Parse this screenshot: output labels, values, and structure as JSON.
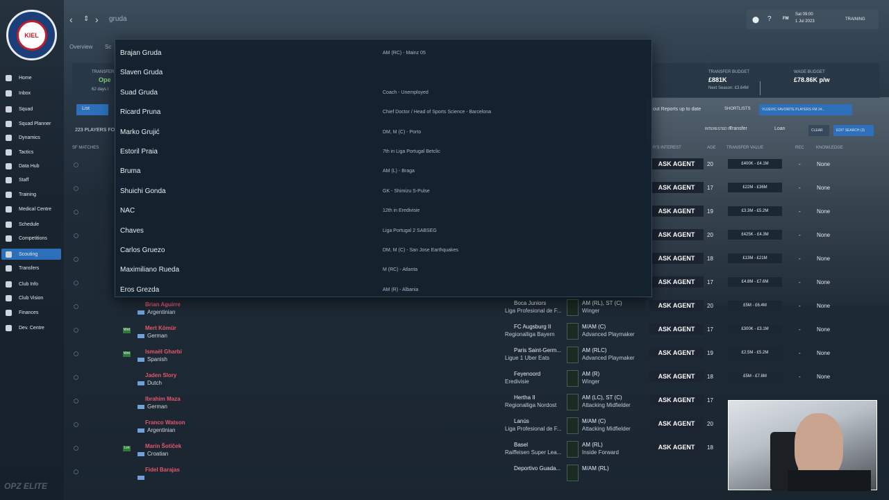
{
  "topbar": {
    "search_text": "gruda",
    "date_line1": "Sat 09:00",
    "date_line2": "1 Jul 2023",
    "fm_label": "FM",
    "training_label": "TRAINING"
  },
  "sidebar": {
    "crest_text": "KIEL",
    "items": [
      {
        "label": "Home"
      },
      {
        "label": "Inbox"
      },
      {
        "label": "Squad"
      },
      {
        "label": "Squad Planner"
      },
      {
        "label": "Dynamics"
      },
      {
        "label": "Tactics"
      },
      {
        "label": "Data Hub"
      },
      {
        "label": "Staff"
      },
      {
        "label": "Training"
      },
      {
        "label": "Medical Centre"
      },
      {
        "label": "Schedule"
      },
      {
        "label": "Competitions"
      },
      {
        "label": "Scouting"
      },
      {
        "label": "Transfers"
      },
      {
        "label": "Club Info"
      },
      {
        "label": "Club Vision"
      },
      {
        "label": "Finances"
      },
      {
        "label": "Dev. Centre"
      }
    ]
  },
  "subtabs": {
    "overview": "Overview",
    "other": "Sc"
  },
  "panel": {
    "transfer_label": "TRANSFER",
    "transfer_status": "Ope",
    "transfer_days": "62 days l",
    "budget_label": "TRANSFER BUDGET",
    "budget_value": "£881K",
    "budget_next": "Next Season: £3.64M",
    "wage_label": "WAGE BUDGET",
    "wage_value": "£78.86K p/w"
  },
  "toolbar": {
    "list_label": "List",
    "players_count": "223 PLAYERS FO",
    "reports_text": "out Reports up to date",
    "shortlists": "SHORTLISTS",
    "favorite": "VUJEVIC FAVORITE PLAYERS FM 24...",
    "interested_in": "INTERESTED IN",
    "transfer": "Transfer",
    "loan": "Loan",
    "clear": "CLEAR",
    "edit_search": "EDIT SEARCH (3)"
  },
  "columns": {
    "sf_matches": "SF MATCHES",
    "interest": "R'S INTEREST",
    "age": "AGE",
    "value": "TRANSFER VALUE",
    "rec": "REC",
    "knowledge": "KNOWLEDGE"
  },
  "dropdown": [
    {
      "name": "Brajan Gruda",
      "desc": "AM (RC) - Mainz 05"
    },
    {
      "name": "Slaven Gruda",
      "desc": ""
    },
    {
      "name": "Suad Gruda",
      "desc": "Coach - Unemployed"
    },
    {
      "name": "Ricard Pruna",
      "desc": "Chief Doctor / Head of Sports Science - Barcelona"
    },
    {
      "name": "Marko Grujić",
      "desc": "DM, M (C) - Porto"
    },
    {
      "name": "Estoril Praia",
      "desc": "7th in Liga Portugal Betclic"
    },
    {
      "name": "Bruma",
      "desc": "AM (L) - Braga"
    },
    {
      "name": "Shuichi Gonda",
      "desc": "GK - Shimizu S-Pulse"
    },
    {
      "name": "NAC",
      "desc": "12th in Eredivisie"
    },
    {
      "name": "Chaves",
      "desc": "Liga Portugal 2 SABSEG"
    },
    {
      "name": "Carlos Gruezo",
      "desc": "DM, M (C) - San Jose Earthquakes"
    },
    {
      "name": "Maximiliano Rueda",
      "desc": "M (RC) - Atlanta"
    },
    {
      "name": "Eros Grezda",
      "desc": "AM (R) - Albania"
    }
  ],
  "rows": [
    {
      "name": "",
      "nation": "",
      "club": "",
      "league": "",
      "pos": "",
      "role": "",
      "ask": "ASK AGENT",
      "age": "20",
      "value": "£400K - £4.1M",
      "rec": "-",
      "knowledge": "None",
      "badge": ""
    },
    {
      "name": "",
      "nation": "",
      "club": "",
      "league": "",
      "pos": "",
      "role": "",
      "ask": "ASK AGENT",
      "age": "17",
      "value": "£22M - £36M",
      "rec": "-",
      "knowledge": "None",
      "badge": ""
    },
    {
      "name": "",
      "nation": "",
      "club": "",
      "league": "",
      "pos": "",
      "role": "",
      "ask": "ASK AGENT",
      "age": "19",
      "value": "£3.3M - £5.2M",
      "rec": "-",
      "knowledge": "None",
      "badge": ""
    },
    {
      "name": "",
      "nation": "",
      "club": "",
      "league": "",
      "pos": "",
      "role": "",
      "ask": "ASK AGENT",
      "age": "20",
      "value": "£425K - £4.3M",
      "rec": "-",
      "knowledge": "None",
      "badge": ""
    },
    {
      "name": "",
      "nation": "",
      "club": "",
      "league": "",
      "pos": "",
      "role": "",
      "ask": "ASK AGENT",
      "age": "18",
      "value": "£13M - £21M",
      "rec": "-",
      "knowledge": "None",
      "badge": ""
    },
    {
      "name": "",
      "nation": "",
      "club": "",
      "league": "",
      "pos": "",
      "role": "",
      "ask": "ASK AGENT",
      "age": "17",
      "value": "£4.8M - £7.6M",
      "rec": "-",
      "knowledge": "None",
      "badge": ""
    },
    {
      "name": "Brian Aguirre",
      "nation": "Argentinian",
      "club": "Boca Juniors",
      "league": "Liga Profesional de F...",
      "pos": "AM (RL), ST (C)",
      "role": "Winger",
      "ask": "ASK AGENT",
      "age": "20",
      "value": "£5M - £6.4M",
      "rec": "-",
      "knowledge": "None",
      "badge": ""
    },
    {
      "name": "Mert Kömür",
      "nation": "German",
      "club": "FC Augsburg II",
      "league": "Regionalliga Bayern",
      "pos": "M/AM (C)",
      "role": "Advanced Playmaker",
      "ask": "ASK AGENT",
      "age": "17",
      "value": "£300K - £3.1M",
      "rec": "-",
      "knowledge": "None",
      "badge": "Wnt"
    },
    {
      "name": "Ismaël Gharbi",
      "nation": "Spanish",
      "club": "Paris Saint-Germ...",
      "league": "Ligue 1 Uber Eats",
      "pos": "AM (RLC)",
      "role": "Advanced Playmaker",
      "ask": "ASK AGENT",
      "age": "19",
      "value": "£2.5M - £5.2M",
      "rec": "-",
      "knowledge": "None",
      "badge": "Wnt"
    },
    {
      "name": "Jaden Slory",
      "nation": "Dutch",
      "club": "Feyenoord",
      "league": "Eredivisie",
      "pos": "AM (R)",
      "role": "Winger",
      "ask": "ASK AGENT",
      "age": "18",
      "value": "£5M - £7.8M",
      "rec": "-",
      "knowledge": "None",
      "badge": ""
    },
    {
      "name": "Ibrahim Maza",
      "nation": "German",
      "club": "Hertha II",
      "league": "Regionalliga Nordost",
      "pos": "AM (LC), ST (C)",
      "role": "Attacking Midfielder",
      "ask": "ASK AGENT",
      "age": "17",
      "value": "",
      "rec": "",
      "knowledge": "",
      "badge": ""
    },
    {
      "name": "Franco Watson",
      "nation": "Argentinian",
      "club": "Lanús",
      "league": "Liga Profesional de F...",
      "pos": "M/AM (C)",
      "role": "Attacking Midfielder",
      "ask": "ASK AGENT",
      "age": "20",
      "value": "",
      "rec": "",
      "knowledge": "",
      "badge": ""
    },
    {
      "name": "Marin Šotiček",
      "nation": "Croatian",
      "club": "Basel",
      "league": "Raiffeisen Super Lea...",
      "pos": "AM (RL)",
      "role": "Inside Forward",
      "ask": "ASK AGENT",
      "age": "18",
      "value": "",
      "rec": "",
      "knowledge": "",
      "badge": "Lsn"
    },
    {
      "name": "Fidel Barajas",
      "nation": "",
      "club": "Deportivo Guada...",
      "league": "",
      "pos": "M/AM (RL)",
      "role": "",
      "ask": "",
      "age": "",
      "value": "",
      "rec": "",
      "knowledge": "",
      "badge": ""
    }
  ],
  "watermark": "OPZ ELITE"
}
